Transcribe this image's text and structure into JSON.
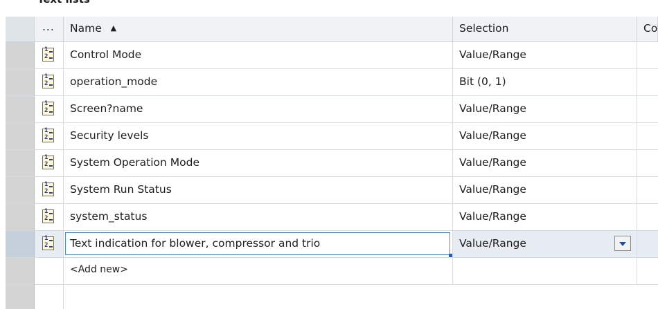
{
  "panel": {
    "title": "Text lists"
  },
  "header": {
    "icon_col": "...",
    "name": "Name",
    "sort_indicator": "▲",
    "selection": "Selection",
    "next_col": "Co"
  },
  "rows": [
    {
      "name": "Control Mode",
      "selection": "Value/Range",
      "icon": "text-list-icon"
    },
    {
      "name": "operation_mode",
      "selection": "Bit (0, 1)",
      "icon": "text-list-icon"
    },
    {
      "name": "Screen?name",
      "selection": "Value/Range",
      "icon": "text-list-icon"
    },
    {
      "name": "Security levels",
      "selection": "Value/Range",
      "icon": "text-list-icon"
    },
    {
      "name": "System Operation Mode",
      "selection": "Value/Range",
      "icon": "text-list-icon"
    },
    {
      "name": "System Run Status",
      "selection": "Value/Range",
      "icon": "text-list-icon"
    },
    {
      "name": "system_status",
      "selection": "Value/Range",
      "icon": "text-list-icon"
    },
    {
      "name": "Text indication for blower, compressor and trio",
      "selection": "Value/Range",
      "icon": "text-list-icon",
      "editing": true
    }
  ],
  "add_new": "<Add new>",
  "colors": {
    "accent": "#1f5fc4",
    "header_bg": "#f0f3f6",
    "row_selector": "#d4d4d4"
  }
}
